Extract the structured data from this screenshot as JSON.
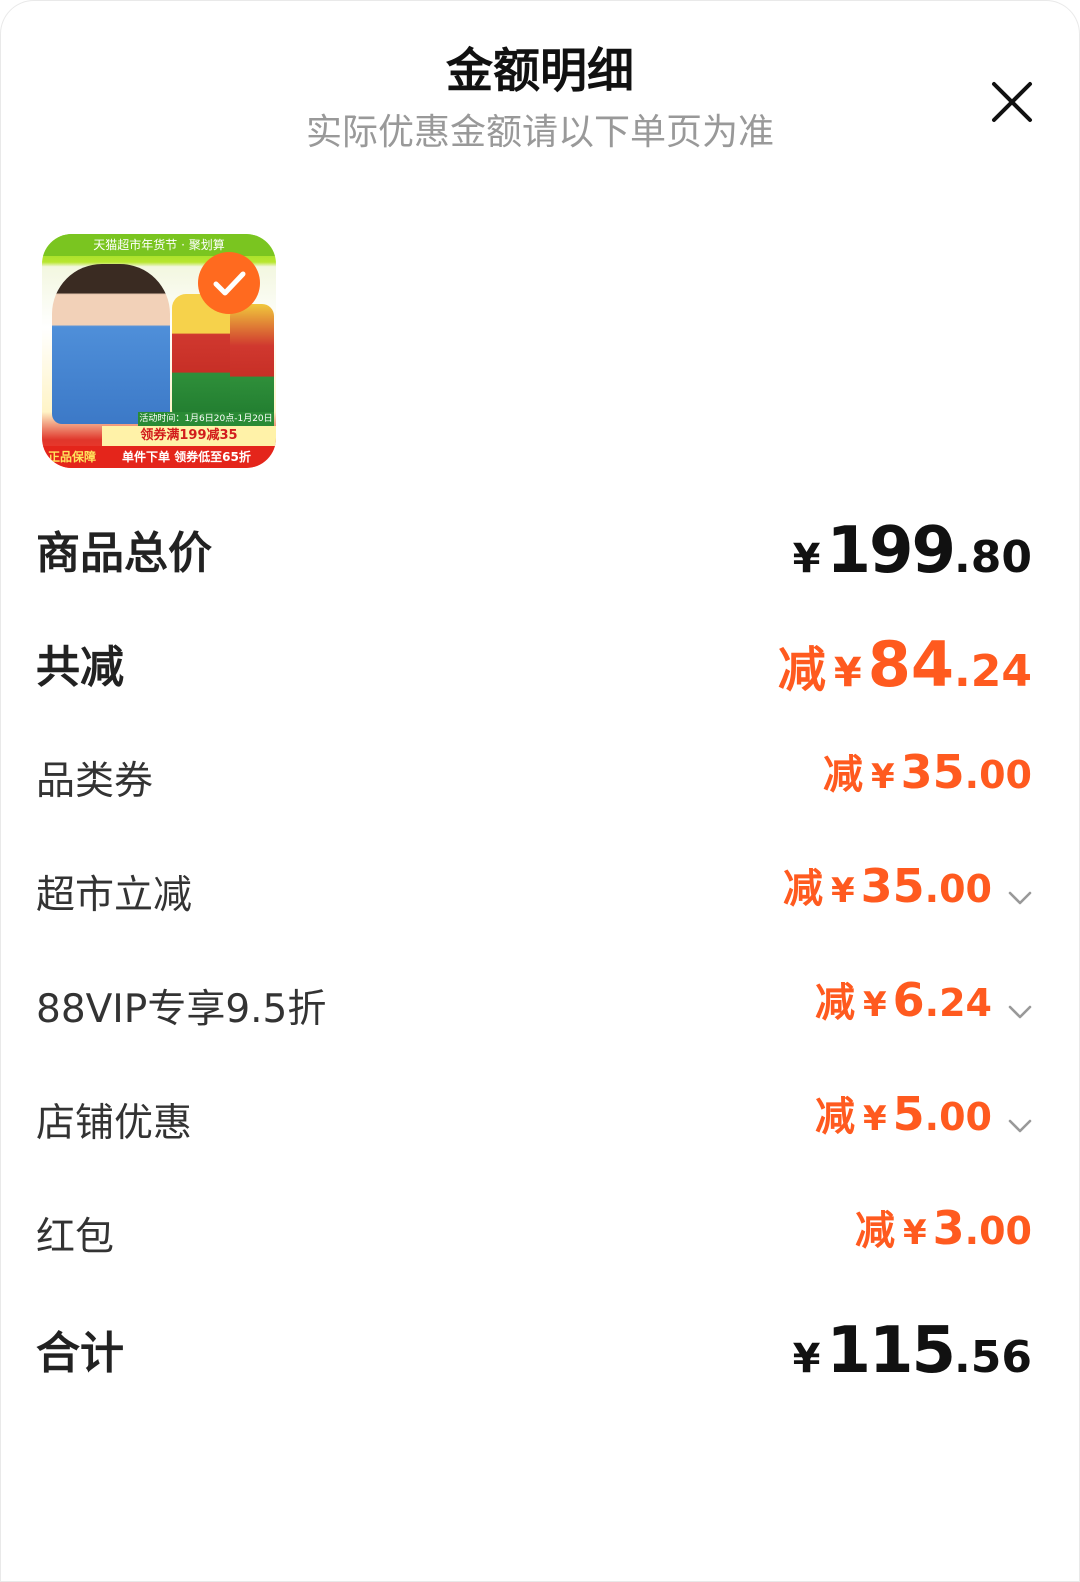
{
  "header": {
    "title": "金额明细",
    "subtitle": "实际优惠金额请以下单页为准"
  },
  "icons": {
    "close": "close-icon",
    "check": "checkmark-icon",
    "chevron": "chevron-down-icon"
  },
  "colors": {
    "accent": "#ff5a1f",
    "text": "#222222",
    "muted": "#999999"
  },
  "product": {
    "top_banner": "天猫超市年货节 · 聚划算",
    "date_strip": "活动时间：1月6日20点-1月20日",
    "coupon_text": "领券满199减35",
    "badge_left": "正品保障",
    "badge_right": "单件下单 领券低至65折"
  },
  "rows": [
    {
      "label": "商品总价",
      "prefix": "",
      "yen": "¥",
      "int": "199",
      "dec": ".80"
    },
    {
      "label": "共减",
      "prefix": "减",
      "yen": "¥",
      "int": "84",
      "dec": ".24"
    },
    {
      "label": "品类券",
      "prefix": "减",
      "yen": "¥",
      "int": "35",
      "dec": ".00"
    },
    {
      "label": "超市立减",
      "prefix": "减",
      "yen": "¥",
      "int": "35",
      "dec": ".00"
    },
    {
      "label": "88VIP专享9.5折",
      "prefix": "减",
      "yen": "¥",
      "int": "6",
      "dec": ".24"
    },
    {
      "label": "店铺优惠",
      "prefix": "减",
      "yen": "¥",
      "int": "5",
      "dec": ".00"
    },
    {
      "label": "红包",
      "prefix": "减",
      "yen": "¥",
      "int": "3",
      "dec": ".00"
    },
    {
      "label": "合计",
      "prefix": "",
      "yen": "¥",
      "int": "115",
      "dec": ".56"
    }
  ]
}
